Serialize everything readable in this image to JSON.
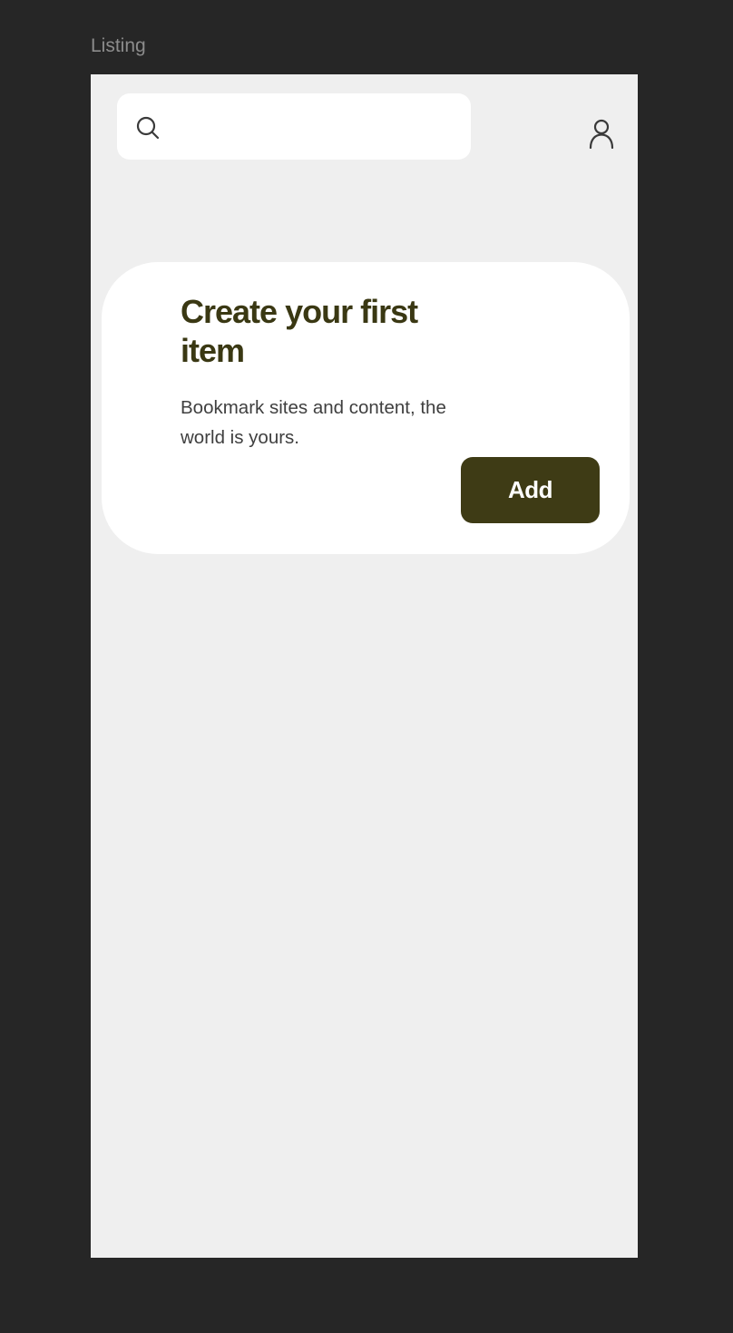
{
  "frame": {
    "label": "Listing"
  },
  "header": {
    "search": {
      "icon": "search-icon",
      "placeholder": "",
      "value": ""
    },
    "profile_icon": "profile-icon"
  },
  "empty_state": {
    "title": "Create your first item",
    "description": "Bookmark sites and content, the world is yours.",
    "add_label": "Add"
  },
  "colors": {
    "page_background": "#262626",
    "screen_background": "#efefef",
    "card_background": "#ffffff",
    "accent": "#3e3b15",
    "title_text": "#3a3813"
  }
}
